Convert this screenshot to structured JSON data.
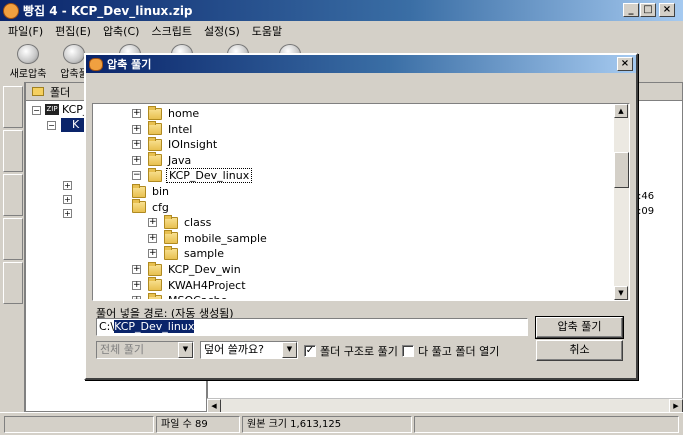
{
  "window": {
    "title": "빵집 4 - KCP_Dev_linux.zip",
    "controls": {
      "minimize": "_",
      "maximize": "□",
      "close": "×"
    }
  },
  "menu": [
    "파일(F)",
    "편집(E)",
    "압축(C)",
    "스크립트",
    "설정(S)",
    "도움말"
  ],
  "toolbar": [
    "새로압축",
    "압축풀"
  ],
  "folder_pane": {
    "header": "폴더",
    "root_label": "KCP_",
    "root_badge": "ZIP",
    "child_label": "K"
  },
  "right_pane": {
    "times": [
      ":46",
      ":09"
    ]
  },
  "status": {
    "file_count_label": "파일 수",
    "file_count": "89",
    "orig_size_label": "원본 크기",
    "orig_size": "1,613,125"
  },
  "dialog": {
    "title": "압축 풀기",
    "close": "×",
    "tree": [
      {
        "label": "home",
        "expander": "+",
        "level": 0
      },
      {
        "label": "Intel",
        "expander": "+",
        "level": 0
      },
      {
        "label": "IOInsight",
        "expander": "+",
        "level": 0
      },
      {
        "label": "Java",
        "expander": "+",
        "level": 0
      },
      {
        "label": "KCP_Dev_linux",
        "expander": "−",
        "level": 0,
        "selected": true
      },
      {
        "label": "bin",
        "expander": "",
        "level": 1
      },
      {
        "label": "cfg",
        "expander": "",
        "level": 1
      },
      {
        "label": "class",
        "expander": "+",
        "level": 1
      },
      {
        "label": "mobile_sample",
        "expander": "+",
        "level": 1
      },
      {
        "label": "sample",
        "expander": "+",
        "level": 1
      },
      {
        "label": "KCP_Dev_win",
        "expander": "+",
        "level": 0
      },
      {
        "label": "KWAH4Project",
        "expander": "+",
        "level": 0
      },
      {
        "label": "MSOCache",
        "expander": "+",
        "level": 0
      }
    ],
    "path_label": "풀어 넣을 경로: (자동 생성됨)",
    "path_prefix": "C:\\",
    "path_selected": "KCP_Dev_linux",
    "extract_button": "압축 풀기",
    "cancel_button": "취소",
    "scope_select": "전체 풀기",
    "overwrite_select": "덮어 쓸까요?",
    "keep_structure_label": "폴더 구조로 풀기",
    "keep_structure_checked": true,
    "open_folder_label": "다 풀고 폴더 열기",
    "open_folder_checked": false
  }
}
